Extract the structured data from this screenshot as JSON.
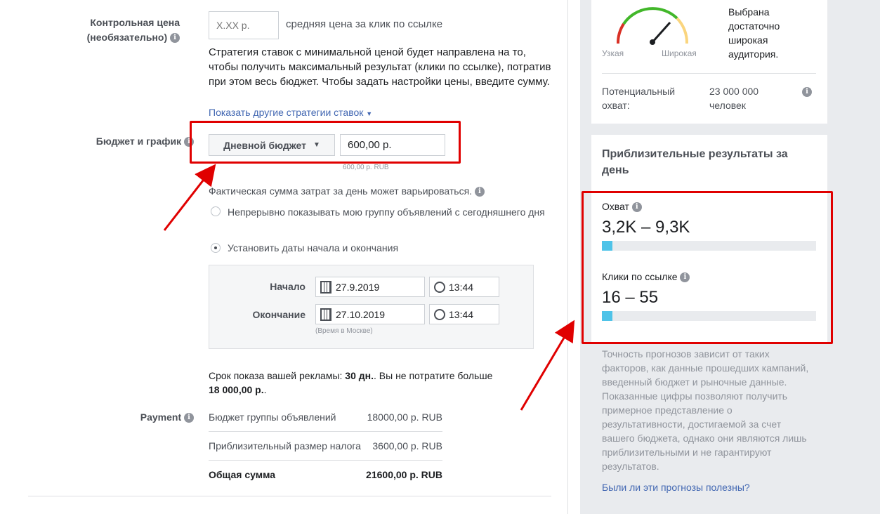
{
  "bid": {
    "label_line1": "Контрольная цена",
    "label_line2": "(необязательно)",
    "placeholder": "X.XX р.",
    "suffix": "средняя цена за клик по ссылке",
    "description": "Стратегия ставок с минимальной ценой будет направлена на то, чтобы получить максимальный результат (клики по ссылке), потратив при этом весь бюджет. Чтобы задать настройки цены, введите сумму.",
    "more_link": "Показать другие стратегии ставок"
  },
  "budget": {
    "label": "Бюджет и график",
    "type_label": "Дневной бюджет",
    "amount": "600,00 р.",
    "amount_hint": "600,00 р. RUB",
    "note": "Фактическая сумма затрат за день может варьироваться.",
    "option1": "Непрерывно показывать мою группу объявлений с сегодняшнего дня",
    "option2": "Установить даты начала и окончания",
    "start_label": "Начало",
    "start_date": "27.9.2019",
    "start_time": "13:44",
    "end_label": "Окончание",
    "end_date": "27.10.2019",
    "end_time": "13:44",
    "timezone": "(Время в Москве)",
    "duration_prefix": "Срок показа вашей рекламы: ",
    "duration_days": "30 дн.",
    "duration_middle": ". Вы не потратите больше",
    "duration_total": "18 000,00 р.",
    "duration_suffix": "."
  },
  "payment": {
    "label": "Payment",
    "rows": [
      {
        "name": "Бюджет группы объявлений",
        "value": "18000,00 р. RUB"
      },
      {
        "name": "Приблизительный размер налога",
        "value": "3600,00 р. RUB"
      }
    ],
    "total_name": "Общая сумма",
    "total_value": "21600,00 р. RUB"
  },
  "audience": {
    "narrow": "Узкая",
    "wide": "Широкая",
    "status": "Выбрана достаточно широкая аудитория.",
    "reach_label_line1": "Потенциальный",
    "reach_label_line2": "охват:",
    "reach_value_line1": "23 000 000",
    "reach_value_line2": "человек"
  },
  "estimates": {
    "title": "Приблизительные результаты за день",
    "reach_label": "Охват",
    "reach_value": "3,2K – 9,3K",
    "reach_fill": 0.05,
    "clicks_label": "Клики по ссылке",
    "clicks_value": "16 – 55",
    "clicks_fill": 0.05,
    "disclaimer": "Точность прогнозов зависит от таких факторов, как данные прошедших кампаний, введенный бюджет и рыночные данные. Показанные цифры позволяют получить примерное представление о результативности, достигаемой за счет вашего бюджета, однако они являются лишь приблизительными и не гарантируют результатов.",
    "feedback_link": "Были ли эти прогнозы полезны?"
  },
  "colors": {
    "annotation": "#e00000",
    "bar": "#4fc3e8",
    "link": "#4267b2"
  }
}
